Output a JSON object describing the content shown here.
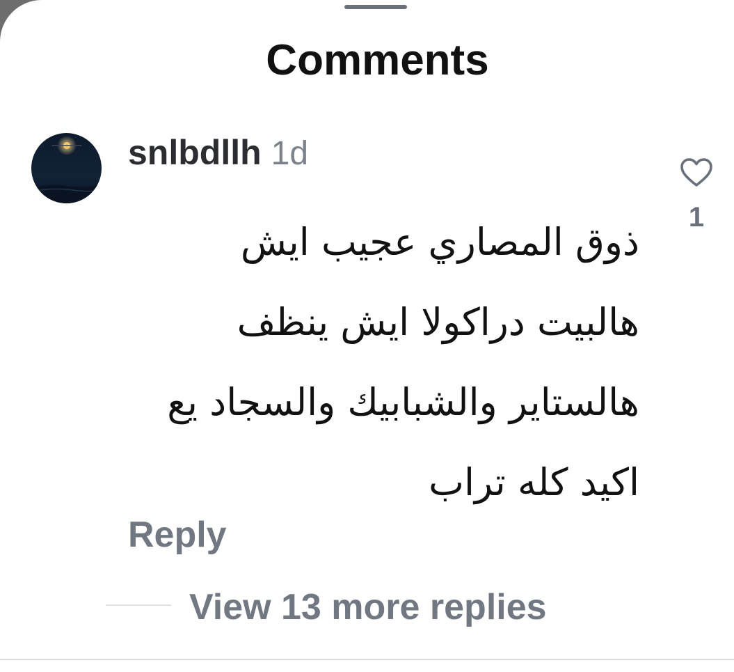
{
  "sheet": {
    "title": "Comments"
  },
  "comment": {
    "username": "snlbdllh",
    "timestamp": "1d",
    "text_lines": [
      "ذوق المصاري عجيب ايش",
      "هالبيت دراكولا ايش ينظف",
      "هالستاير والشبابيك والسجاد يع",
      "اكيد كله تراب"
    ],
    "reply_label": "Reply",
    "view_replies_label": "View 13 more replies",
    "like_count": "1",
    "avatar_icon": "night-moon-avatar",
    "like_icon": "heart-outline-icon"
  },
  "colors": {
    "background": "#ffffff",
    "title": "#111111",
    "username": "#2b2d31",
    "muted": "#727882",
    "divider": "#dfe1e4"
  }
}
